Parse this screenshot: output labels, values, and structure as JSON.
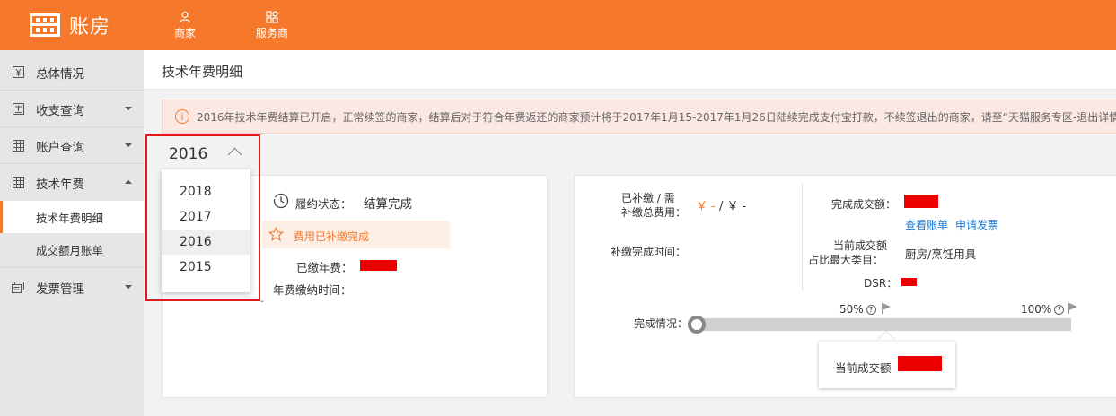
{
  "app": {
    "title": "账房"
  },
  "topnav": [
    {
      "label": "商家",
      "icon": "user-icon"
    },
    {
      "label": "服务商",
      "icon": "grid-icon"
    }
  ],
  "sidebar": {
    "items": [
      {
        "label": "总体情况",
        "icon": "yen-icon"
      },
      {
        "label": "收支查询",
        "icon": "document-icon"
      },
      {
        "label": "账户查询",
        "icon": "table-icon"
      },
      {
        "label": "技术年费",
        "icon": "table-icon",
        "expanded": true
      },
      {
        "label": "发票管理",
        "icon": "invoice-icon"
      }
    ],
    "subitems": [
      {
        "label": "技术年费明细",
        "active": true
      },
      {
        "label": "成交额月账单",
        "active": false
      }
    ]
  },
  "page": {
    "title": "技术年费明细"
  },
  "notice": {
    "text": "2016年技术年费结算已开启，正常续签的商家，结算后对于符合年费返还的商家预计将于2017年1月15-2017年1月26日陆续完成支付宝打款，不续签退出的商家，请至“天猫服务专区-退出详情”"
  },
  "year_select": {
    "current": "2016",
    "options": [
      "2018",
      "2017",
      "2016",
      "2015"
    ],
    "hovered": "2016"
  },
  "fee_card": {
    "status_label": "履约状态：",
    "status_value": "结算完成",
    "badge": "费用已补缴完成",
    "paid_fee_label": "已缴年费：",
    "paid_time_label": "年费缴纳时间：",
    "dash": "-"
  },
  "settle_card": {
    "supplement_label_line1": "已补缴 / 需",
    "supplement_label_line2": "补缴总费用：",
    "supplement_paid": "￥ -",
    "supplement_sep": " / ",
    "supplement_total": "￥ -",
    "supplement_time_label": "补缴完成时间：",
    "completed_amount_label": "完成成交额：",
    "view_bill_link": "查看账单",
    "apply_invoice_link": "申请发票",
    "category_label_line1": "当前成交额",
    "category_label_line2": "占比最大类目：",
    "category_value": "厨房/烹饪用具",
    "dsr_label": "DSR：",
    "progress_label": "完成情况：",
    "mark_50": "50%",
    "mark_100": "100%",
    "tooltip_label": "当前成交额",
    "progress_fraction": 0
  },
  "colors": {
    "brand": "#f6792b",
    "link": "#1c7dd6",
    "redaction": "#ec0000"
  }
}
